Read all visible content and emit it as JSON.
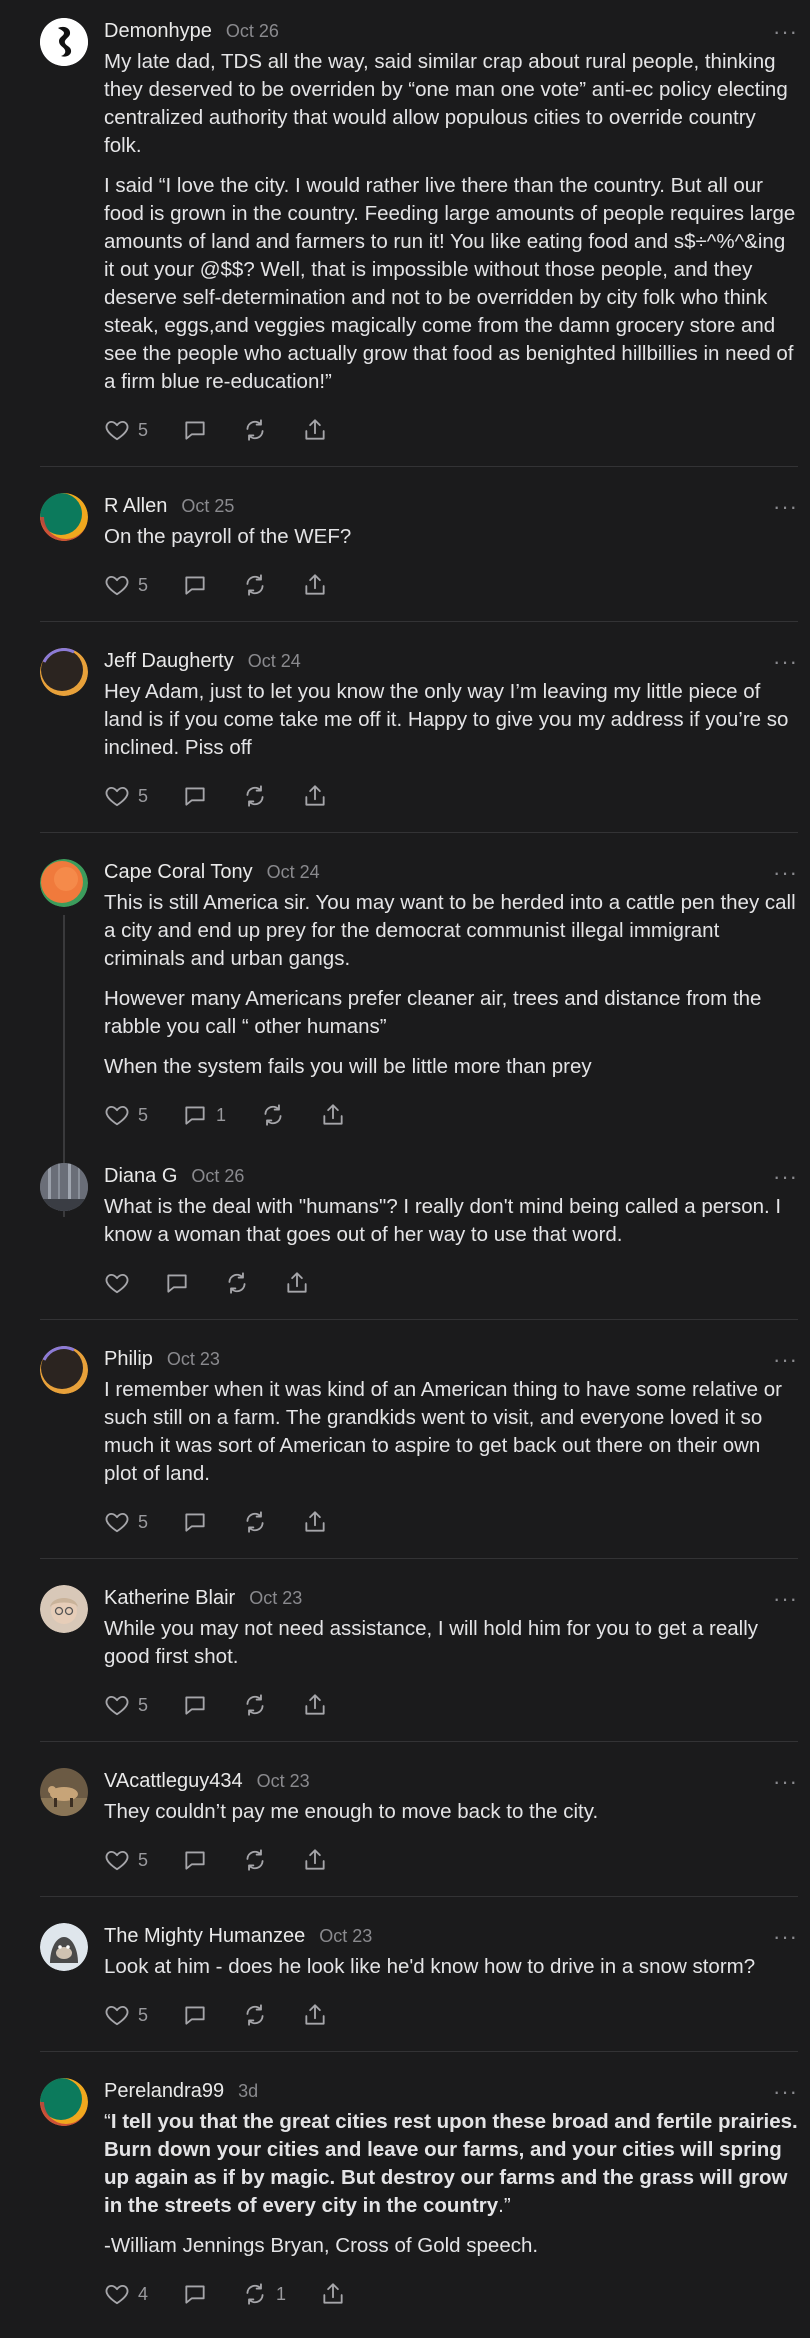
{
  "comments": [
    {
      "name": "Demonhype",
      "date": "Oct 26",
      "paragraphs": [
        "My late dad, TDS all the way, said similar crap about rural people, thinking they deserved to be overriden by “one man one vote” anti-ec policy electing centralized authority that would allow populous cities to override country folk.",
        "I said “I love the city. I would rather live there than the country. But all our food is grown in the country. Feeding large amounts of people requires large amounts of land and farmers to run it! You like eating food and s$÷^%^&ing it out your @$$? Well, that is impossible without those people, and they deserve self-determination and not to be overridden by city folk who think steak, eggs,and veggies magically come from the damn grocery store and see the people who actually grow that food as benighted hillbillies in need of a firm blue re-education!”"
      ],
      "likes": "5",
      "replies": "",
      "restacks": ""
    },
    {
      "name": "R Allen",
      "date": "Oct 25",
      "paragraphs": [
        "On the payroll of the WEF?"
      ],
      "likes": "5",
      "replies": "",
      "restacks": ""
    },
    {
      "name": "Jeff Daugherty",
      "date": "Oct 24",
      "paragraphs": [
        "Hey Adam, just to let you know the only way I’m leaving my little piece of land is if you come take me off it. Happy to give you my address if you’re so inclined. Piss off"
      ],
      "likes": "5",
      "replies": "",
      "restacks": ""
    },
    {
      "name": "Cape Coral Tony",
      "date": "Oct 24",
      "paragraphs": [
        "This is still America sir. You may want to be herded into a cattle pen they call a city and end up prey for the democrat communist illegal immigrant criminals and urban gangs.",
        "However many Americans prefer cleaner air, trees and distance from the rabble you call “ other humans”",
        "When the system fails you will be little more than prey"
      ],
      "likes": "5",
      "replies": "1",
      "restacks": ""
    },
    {
      "name": "Diana G",
      "date": "Oct 26",
      "paragraphs": [
        "What is the deal with \"humans\"? I really don't mind being called a person. I know a woman that goes out of her way to use that word."
      ],
      "likes": "",
      "replies": "",
      "restacks": ""
    },
    {
      "name": "Philip",
      "date": "Oct 23",
      "paragraphs": [
        "I remember when it was kind of an American thing to have some relative or such still on a farm. The grandkids went to visit, and everyone loved it so much it was sort of American to aspire to get back out there on their own plot of land."
      ],
      "likes": "5",
      "replies": "",
      "restacks": ""
    },
    {
      "name": "Katherine Blair",
      "date": "Oct 23",
      "paragraphs": [
        "While you may not need assistance, I will hold him for you to get a really good first shot."
      ],
      "likes": "5",
      "replies": "",
      "restacks": ""
    },
    {
      "name": "VAcattleguy434",
      "date": "Oct 23",
      "paragraphs": [
        "They couldn’t pay me enough to move back to the city."
      ],
      "likes": "5",
      "replies": "",
      "restacks": ""
    },
    {
      "name": "The Mighty Humanzee",
      "date": "Oct 23",
      "paragraphs": [
        "Look at him - does he look like he'd know how to drive in a snow storm?"
      ],
      "likes": "5",
      "replies": "",
      "restacks": ""
    },
    {
      "name": "Perelandra99",
      "date": "3d",
      "quote_open": "“",
      "quote_bold": "I tell you that the great cities rest upon these broad and fertile prairies. Burn down your cities and leave our farms, and your cities will spring up again as if by magic. But destroy our farms and the grass will grow in the streets of every city in the country",
      "quote_close": ".”",
      "attribution": "-William Jennings Bryan, Cross of Gold speech.",
      "likes": "4",
      "replies": "",
      "restacks": "1"
    }
  ],
  "more_glyph": "···",
  "colors": {
    "background": "#1b1b1c",
    "text": "#e4e4e6",
    "muted": "#8a8a8e",
    "divider": "#333335"
  },
  "icons": [
    "heart-icon",
    "comment-icon",
    "restack-icon",
    "share-icon",
    "more-icon"
  ]
}
